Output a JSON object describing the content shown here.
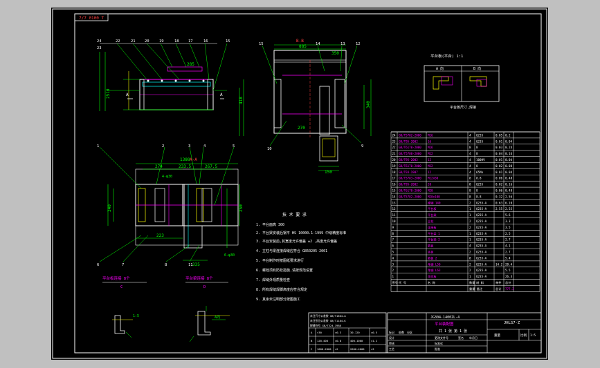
{
  "sheet": {
    "corner_code": "7/7 0100 T",
    "top_view_label": "B-B",
    "middle_view_label": "A-A",
    "note_title": "技 术 要 求",
    "notes": [
      "1. 平台面高 300",
      "2. 平台梁安装后钢平 HS 10000.1-1999 中级精度标准",
      "3. 平台安装后,其宽度允许偏差 ±2 ,高度允许偏差",
      "4. 立柱与梁连接焊缝应符合 GB50205-2001",
      "5. 平台制作时按图纸要求进行",
      "6. 螺栓须有防松措施,请按规范设置",
      "7. 焊缝外观质量检查",
      "8. 所有焊缝焊脚高度应符合规定",
      "9. 其余未注明部分按图施工"
    ],
    "dims": {
      "v1_left": "2510",
      "v1_mid": "285",
      "v2_w1": "885",
      "v2_w2": "350",
      "v2_h1": "418",
      "v2_h2": "340",
      "v2_b1": "270",
      "v2_b2": "150",
      "v3_w1": "1380",
      "v3_w2": "233.5",
      "v3_w3": "267.5",
      "v3_w4": "274",
      "v3_h1": "340",
      "v3_h2": "250",
      "v3_b1": "223",
      "v3_b2": "335",
      "d1": "4-φ30",
      "d2": "6-φ30"
    },
    "callouts": [
      "24",
      "23",
      "22",
      "21",
      "20",
      "19",
      "18",
      "17",
      "16",
      "15",
      "14",
      "13",
      "12",
      "11",
      "10",
      "9",
      "8",
      "7",
      "6",
      "5",
      "4",
      "3",
      "2",
      "1"
    ],
    "section_labels": [
      "A向",
      "1:5",
      "B",
      "C",
      "D"
    ],
    "detail_caption_1": "平台板连接 8个",
    "detail_caption_2": "平台梁连接 8个",
    "inset_title": "平台板(平台) 1:1",
    "inset_caption": "平台板尺寸,焊接",
    "inset_dim_a": "A 向",
    "inset_dim_b": "B 向"
  },
  "bom": {
    "rows": [
      [
        "24",
        "GB/T5782-2000",
        "M16",
        "4",
        "Q235",
        "0.05",
        "0.2"
      ],
      [
        "23",
        "GB/T95-2002",
        "16",
        "4",
        "Q235",
        "0.01",
        "0.04"
      ],
      [
        "22",
        "GB/T6170-2000",
        "M16",
        "8",
        "8",
        "0.03",
        "0.24"
      ],
      [
        "21",
        "GB/T5780-2000",
        "M12",
        "4",
        "8",
        "0.04",
        "0.16"
      ],
      [
        "20",
        "GB/T95-2002",
        "12",
        "4",
        "100HV",
        "0.01",
        "0.04"
      ],
      [
        "19",
        "GB/T6170-2000",
        "M12",
        "4",
        "8",
        "0.02",
        "0.08"
      ],
      [
        "18",
        "GB/T93-1987",
        "12",
        "4",
        "65Mn",
        "0.01",
        "0.04"
      ],
      [
        "17",
        "GB/T5783-2000",
        "M12x60",
        "8",
        "8.8",
        "0.06",
        "0.48"
      ],
      [
        "16",
        "GB/T95-2002",
        "20",
        "8",
        "Q235",
        "0.02",
        "0.16"
      ],
      [
        "15",
        "GB/T6170-2000",
        "M20",
        "8",
        "8",
        "0.06",
        "0.48"
      ],
      [
        "14",
        "GB/T5782-2000",
        "M20x100",
        "8",
        "8.8",
        "0.32",
        "2.56"
      ],
      [
        "13",
        "",
        "槽钢 140",
        "2",
        "Q235-A",
        "0.63",
        "6.10"
      ],
      [
        "12",
        "",
        "平台板",
        "1",
        "Q235-A",
        "2.55",
        "2.55"
      ],
      [
        "11",
        "",
        "平台梁",
        "1",
        "Q235-A",
        "",
        "5.6"
      ],
      [
        "10",
        "",
        "立柱",
        "2",
        "Q235-A",
        "",
        "3.3"
      ],
      [
        "9",
        "",
        "连接板",
        "2",
        "Q235-A",
        "",
        "3.5"
      ],
      [
        "8",
        "",
        "平台梁 1",
        "1",
        "Q235-A",
        "",
        "2.5"
      ],
      [
        "7",
        "",
        "平台梁 2",
        "1",
        "Q235-A",
        "",
        "2.7"
      ],
      [
        "6",
        "",
        "筋板",
        "4",
        "Q235-A",
        "",
        "4.1"
      ],
      [
        "5",
        "",
        "底板",
        "2",
        "Q235-A",
        "",
        "2.7"
      ],
      [
        "4",
        "",
        "筋板 2",
        "8",
        "Q235-A",
        "",
        "5.4"
      ],
      [
        "3",
        "",
        "角钢 L50",
        "2",
        "Q235-A",
        "14.2",
        "28.4"
      ],
      [
        "2",
        "",
        "角钢 L63",
        "2",
        "Q235-A",
        "",
        "5.5"
      ],
      [
        "1",
        "",
        "花纹板",
        "1",
        "Q235-A",
        "",
        "26.3"
      ]
    ],
    "header": [
      "序号",
      "代 号",
      "名 称",
      "数量",
      "材 料",
      "单件",
      "总计"
    ],
    "header2": "重量 备注",
    "total_label": "总计",
    "total_value": "777.3"
  },
  "title_block": {
    "drawing_no": "JG304-1400ZL-4",
    "name": "平台装配图",
    "drawing_code": "JHLS7-Z",
    "weight_label": "重量",
    "scale_label": "比例",
    "scale": "1:5",
    "sheet_info": "共 1 张 第 1 张",
    "rev_rows": [
      [
        "标记",
        "处数",
        "分区",
        "更改文件号",
        "签名",
        "年月日"
      ],
      [
        "设计",
        "",
        "",
        "标准化",
        "",
        ""
      ],
      [
        "审核",
        "",
        "",
        "",
        "",
        " "
      ],
      [
        "工艺",
        "",
        "",
        "批准",
        "",
        ""
      ]
    ]
  },
  "left_block": {
    "line1": "未注尺寸公差按 GB/T1804-m",
    "line2": "未注形位公差按 GB/T1184-K",
    "line3": "焊缝符号 GB/T324-1988",
    "rows": [
      [
        "A",
        ">30",
        "±0.3",
        "30-120",
        "±0.5"
      ],
      [
        "B",
        "120-400",
        "±0.8",
        "400-1000",
        "±1.2"
      ],
      [
        "C",
        "1000-2000",
        "±2",
        "2000-4000",
        "±3"
      ]
    ]
  }
}
